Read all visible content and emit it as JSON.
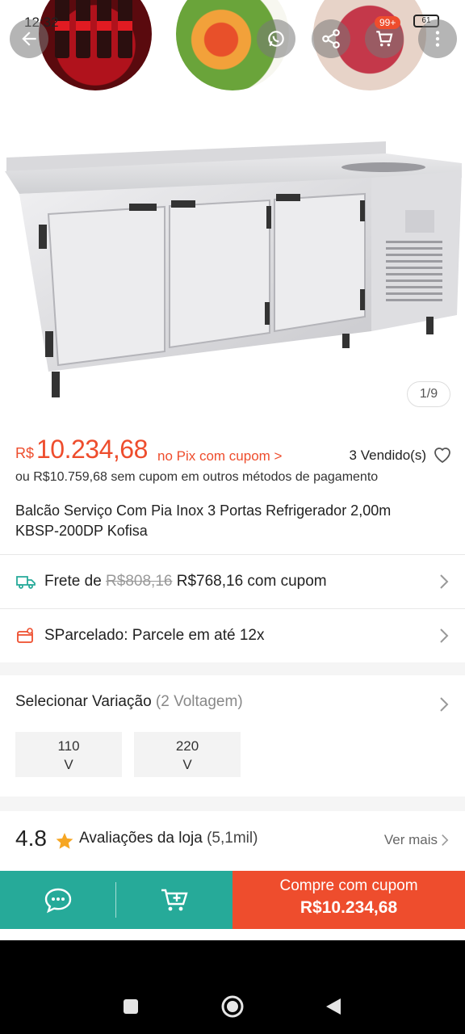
{
  "status": {
    "time": "12:32",
    "badge": "99+",
    "battery": "61"
  },
  "gallery": {
    "counter": "1/9"
  },
  "price": {
    "currency": "R$",
    "value": "10.234,68",
    "pix_link": "no Pix com cupom >",
    "sold": "3 Vendido(s)",
    "alt_price": "ou R$10.759,68 sem cupom em outros métodos de pagamento"
  },
  "product": {
    "title": "Balcão Serviço Com Pia Inox 3 Portas Refrigerador 2,00m KBSP-200DP Kofisa"
  },
  "shipping": {
    "label": "Frete de",
    "old_price": "R$808,16",
    "new_price": "R$768,16 com cupom"
  },
  "installments": {
    "label": "SParcelado: Parcele em até 12x"
  },
  "variation": {
    "title": "Selecionar Variação",
    "count": "(2 Voltagem)",
    "options": [
      {
        "line1": "110",
        "line2": "V"
      },
      {
        "line1": "220",
        "line2": "V"
      }
    ]
  },
  "rating": {
    "score": "4.8",
    "label": "Avaliações da loja",
    "count": "(5,1mil)",
    "see_more": "Ver mais"
  },
  "actions": {
    "buy_line1": "Compre com cupom",
    "buy_line2": "R$10.234,68"
  },
  "colors": {
    "accent": "#ee4d2d",
    "teal": "#26aa99"
  },
  "icons": [
    "back-arrow-icon",
    "whatsapp-icon",
    "share-icon",
    "cart-icon",
    "more-icon",
    "heart-icon",
    "truck-icon",
    "installment-icon",
    "chevron-right-icon",
    "star-icon",
    "chat-icon",
    "add-to-cart-icon",
    "nav-square-icon",
    "nav-home-icon",
    "nav-back-icon"
  ]
}
